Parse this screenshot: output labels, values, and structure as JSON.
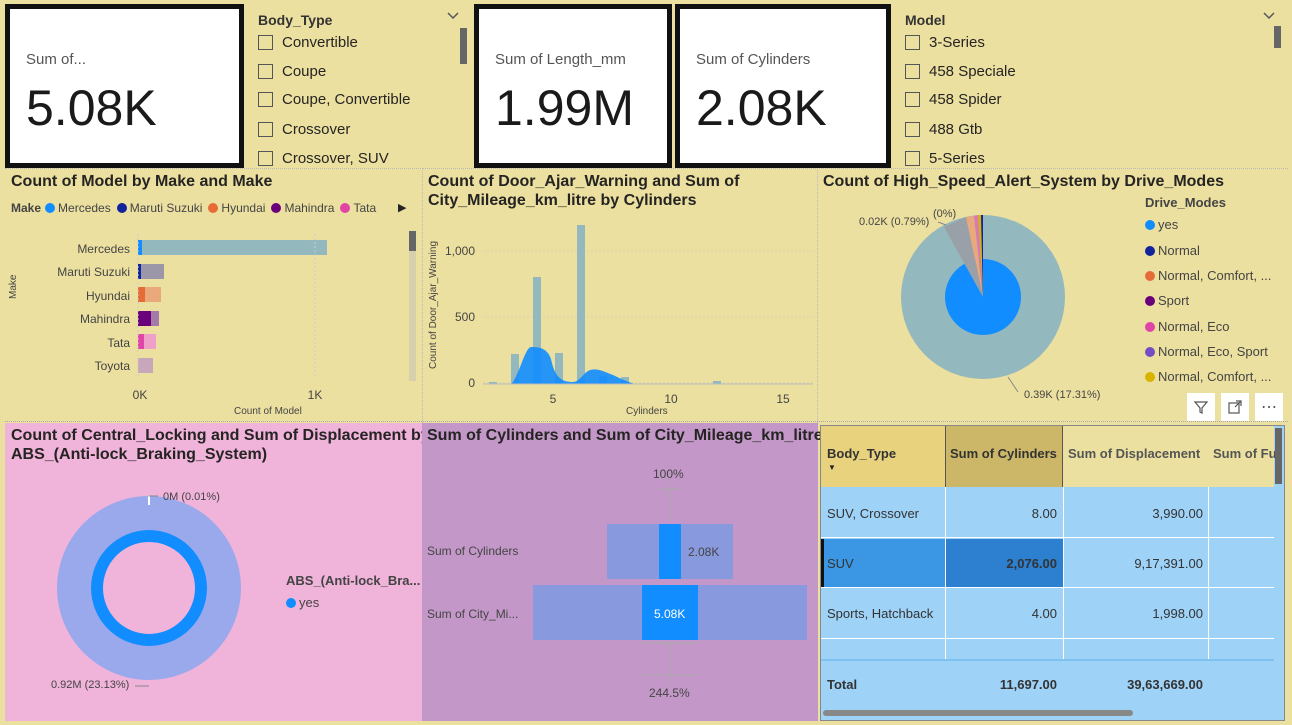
{
  "cards": {
    "card1": {
      "label": "Sum of...",
      "value": "5.08K"
    },
    "card2": {
      "label": "Sum of Length_mm",
      "value": "1.99M"
    },
    "card3": {
      "label": "Sum of Cylinders",
      "value": "2.08K"
    }
  },
  "body_type_slicer": {
    "title": "Body_Type",
    "items": [
      "Convertible",
      "Coupe",
      "Coupe, Convertible",
      "Crossover",
      "Crossover, SUV"
    ]
  },
  "model_slicer": {
    "title": "Model",
    "items": [
      "3-Series",
      "458 Speciale",
      "458 Spider",
      "488 Gtb",
      "5-Series"
    ]
  },
  "make_chart": {
    "title": "Count of Model by Make and Make",
    "legend_title": "Make",
    "legend": [
      {
        "name": "Mercedes",
        "color": "#118dff"
      },
      {
        "name": "Maruti Suzuki",
        "color": "#12239e"
      },
      {
        "name": "Hyundai",
        "color": "#e66c37"
      },
      {
        "name": "Mahindra",
        "color": "#6b007b"
      },
      {
        "name": "Tata",
        "color": "#e044a7"
      }
    ],
    "y_axis_title": "Make",
    "x_axis_title": "Count of Model",
    "x_ticks": [
      "0K",
      "1K"
    ]
  },
  "door_chart": {
    "title_line1": "Count of Door_Ajar_Warning and Sum of",
    "title_line2": "City_Mileage_km_litre by Cylinders",
    "y_axis_title": "Count of Door_Ajar_Warning",
    "x_axis_title": "Cylinders",
    "y_ticks": [
      "1,000",
      "500",
      "0"
    ],
    "x_ticks": [
      "5",
      "10",
      "15"
    ]
  },
  "speed_chart": {
    "title": "Count of High_Speed_Alert_System by Drive_Modes",
    "legend_title": "Drive_Modes",
    "legend": [
      {
        "name": "yes",
        "color": "#118dff"
      },
      {
        "name": "Normal",
        "color": "#12239e"
      },
      {
        "name": "Normal, Comfort, ...",
        "color": "#e66c37"
      },
      {
        "name": "Sport",
        "color": "#6b007b"
      },
      {
        "name": "Normal, Eco",
        "color": "#e044a7"
      },
      {
        "name": "Normal, Eco, Sport",
        "color": "#744ec2"
      },
      {
        "name": "Normal, Comfort, ...",
        "color": "#d9b300"
      }
    ],
    "label_top": "0.02K (0.79%)",
    "label_top2": "(0%)",
    "label_bottom": "0.39K (17.31%)"
  },
  "locking_chart": {
    "title_line1": "Count of Central_Locking and Sum of Displacement by",
    "title_line2": "ABS_(Anti-lock_Braking_System)",
    "label_top": "0M (0.01%)",
    "label_bottom": "0.92M (23.13%)",
    "legend_title": "ABS_(Anti-lock_Bra...",
    "legend_item": "yes"
  },
  "funnel_chart": {
    "title": "Sum of Cylinders and Sum of City_Mileage_km_litre",
    "top_pct": "100%",
    "bottom_pct": "244.5%",
    "rows": [
      {
        "label": "Sum of Cylinders",
        "value": "2.08K"
      },
      {
        "label": "Sum of City_Mi...",
        "value": "5.08K"
      }
    ]
  },
  "matrix": {
    "headers": [
      "Body_Type",
      "Sum of Cylinders",
      "Sum of Displacement",
      "Sum of Fu"
    ],
    "rows": [
      {
        "type": "SUV, Crossover",
        "cyl": "8.00",
        "disp": "3,990.00"
      },
      {
        "type": "SUV",
        "cyl": "2,076.00",
        "disp": "9,17,391.00"
      },
      {
        "type": "Sports, Hatchback",
        "cyl": "4.00",
        "disp": "1,998.00"
      }
    ],
    "total": {
      "type": "Total",
      "cyl": "11,697.00",
      "disp": "39,63,669.00"
    }
  },
  "toolbar": {
    "filter_icon": "filter-icon",
    "focus_icon": "focus-mode-icon",
    "more_icon": "more-options-icon"
  },
  "colors": {
    "canvas": "#ece0a0",
    "pink": "#f0b3da",
    "purple": "#c398c8",
    "accent": "#118dff",
    "teal": "#93b8be"
  }
}
